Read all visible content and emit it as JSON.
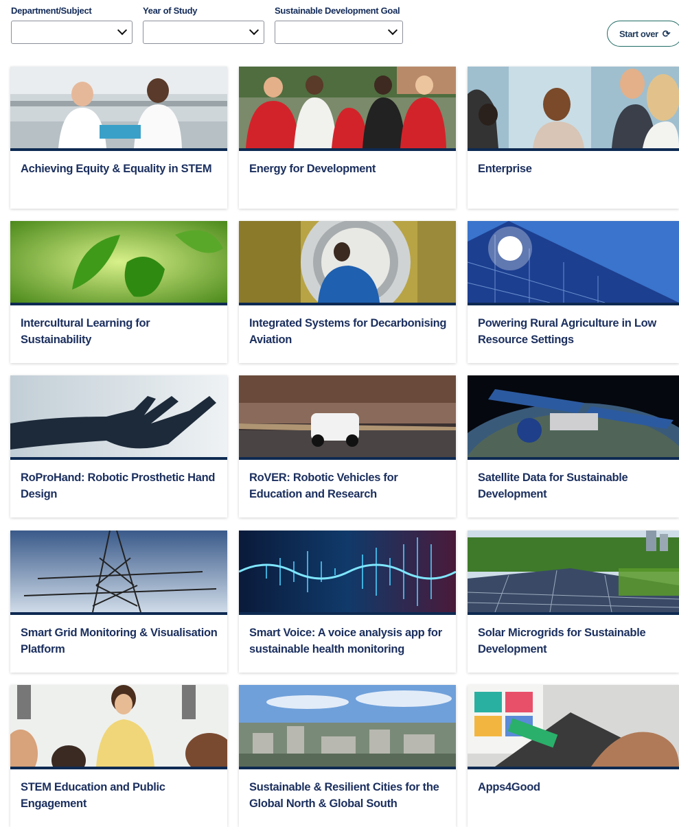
{
  "filters": [
    {
      "label": "Department/Subject",
      "value": ""
    },
    {
      "label": "Year of Study",
      "value": ""
    },
    {
      "label": "Sustainable Development Goal",
      "value": ""
    }
  ],
  "start_over": {
    "label": "Start over",
    "icon": "refresh-icon"
  },
  "cards": [
    {
      "title": "Achieving Equity & Equality in STEM",
      "image": "lab-scientists-photo"
    },
    {
      "title": "Energy for Development",
      "image": "group-red-hoodies-photo"
    },
    {
      "title": "Enterprise",
      "image": "students-discussing-photo"
    },
    {
      "title": "Intercultural Learning for Sustainability",
      "image": "green-leaves-photo"
    },
    {
      "title": "Integrated Systems for Decarbonising Aviation",
      "image": "engineer-in-pipe-photo"
    },
    {
      "title": "Powering Rural Agriculture in Low Resource Settings",
      "image": "solar-panel-sun-photo"
    },
    {
      "title": "RoProHand: Robotic Prosthetic Hand Design",
      "image": "robotic-hand-photo"
    },
    {
      "title": "RoVER: Robotic Vehicles for Education and Research",
      "image": "delivery-robot-photo"
    },
    {
      "title": "Satellite Data for Sustainable Development",
      "image": "satellite-earth-photo"
    },
    {
      "title": "Smart Grid Monitoring & Visualisation Platform",
      "image": "power-pylon-photo"
    },
    {
      "title": "Smart Voice: A voice analysis app for sustainable health monitoring",
      "image": "sound-wave-photo"
    },
    {
      "title": "Solar Microgrids for Sustainable Development",
      "image": "solar-field-photo"
    },
    {
      "title": "STEM Education and Public Engagement",
      "image": "teacher-classroom-photo"
    },
    {
      "title": "Sustainable & Resilient Cities for the Global North & Global South",
      "image": "city-skyline-photo"
    },
    {
      "title": "Apps4Good",
      "image": "phone-app-photo"
    }
  ],
  "colors": {
    "navy": "#0e2a52",
    "title": "#1b2f5e",
    "button_border": "#1e6a62"
  }
}
